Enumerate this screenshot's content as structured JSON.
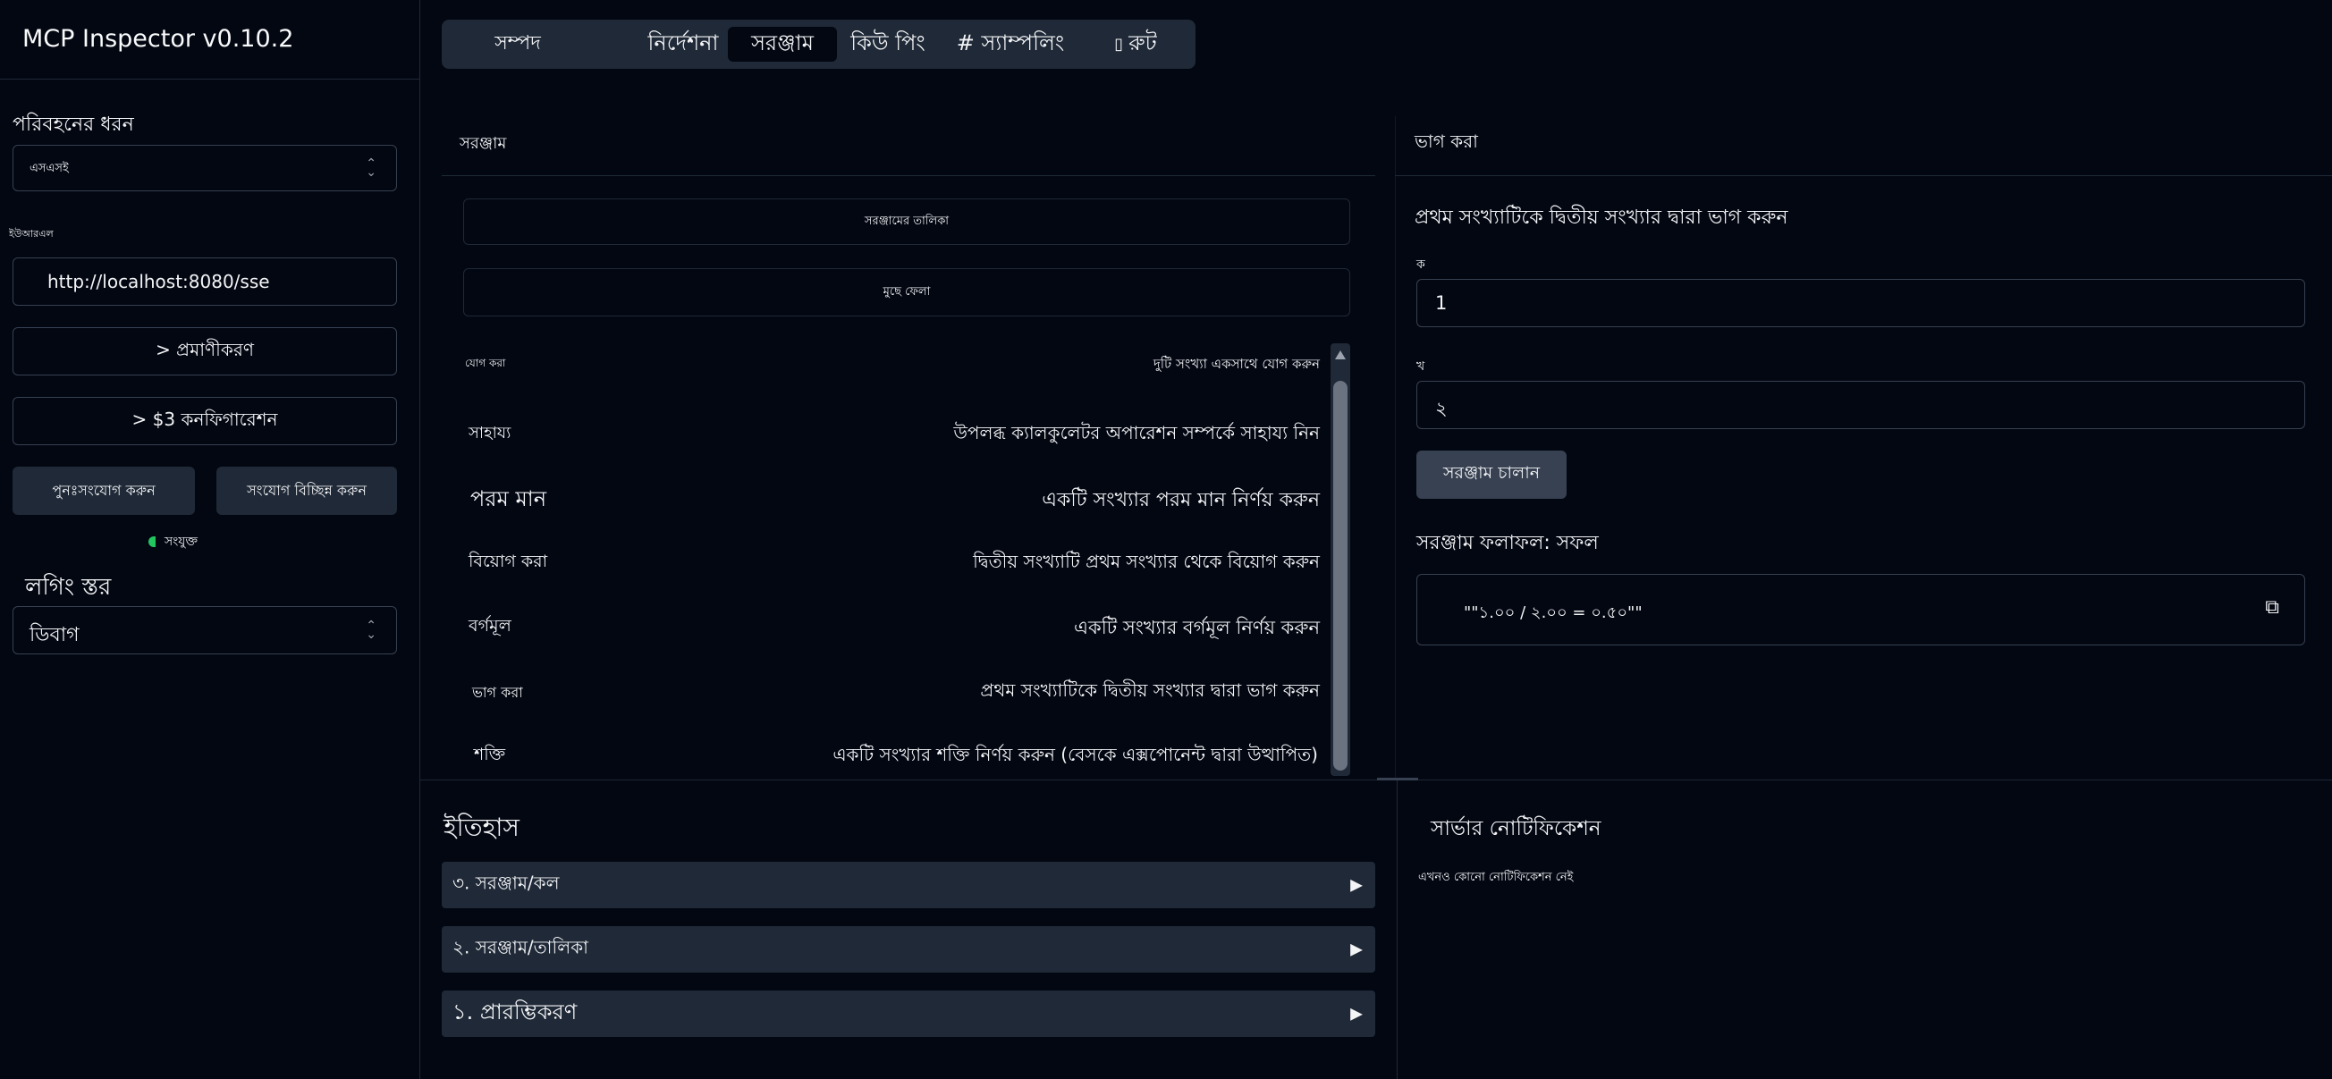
{
  "app": {
    "title": "MCP Inspector v0.10.2"
  },
  "sidebar": {
    "transport_label": "পরিবহনের ধরন",
    "transport_value": "এসএসই",
    "url_label": "ইউআরএল",
    "url_value": "http://localhost:8080/sse",
    "auth_label": "> প্রমাণীকরণ",
    "config_label": "> $3 কনফিগারেশন",
    "reconnect_label": "পুনঃসংযোগ করুন",
    "disconnect_label": "সংযোগ বিচ্ছিন্ন করুন",
    "status_text": "সংযুক্ত",
    "status_color": "#22c55e",
    "log_label": "লগিং স্তর",
    "log_value": "ডিবাগ"
  },
  "tabs": [
    {
      "label": "সম্পদ"
    },
    {
      "label": "নির্দেশনা"
    },
    {
      "label": "সরঞ্জাম"
    },
    {
      "label": "কিউ পিং"
    },
    {
      "label": "# স্যাম্পলিং"
    },
    {
      "label": "রুট"
    }
  ],
  "tools_panel": {
    "heading": "সরঞ্জাম",
    "list_button": "সরঞ্জামের তালিকা",
    "clear_button": "মুছে ফেলা",
    "items": [
      {
        "name": "যোগ করা",
        "desc": "দুটি সংখ্যা একসাথে যোগ করুন"
      },
      {
        "name": "সাহায্য",
        "desc": "উপলব্ধ ক্যালকুলেটর অপারেশন সম্পর্কে সাহায্য নিন"
      },
      {
        "name": "পরম মান",
        "desc": "একটি সংখ্যার পরম মান নির্ণয় করুন"
      },
      {
        "name": "বিয়োগ করা",
        "desc": "দ্বিতীয় সংখ্যাটি প্রথম সংখ্যার থেকে বিয়োগ করুন"
      },
      {
        "name": "বর্গমূল",
        "desc": "একটি সংখ্যার বর্গমূল নির্ণয় করুন"
      },
      {
        "name": "ভাগ করা",
        "desc": "প্রথম সংখ্যাটিকে দ্বিতীয় সংখ্যার দ্বারা ভাগ করুন"
      },
      {
        "name": "শক্তি",
        "desc": "একটি সংখ্যার শক্তি নির্ণয় করুন (বেসকে এক্সপোনেন্ট দ্বারা উত্থাপিত)"
      }
    ]
  },
  "detail_panel": {
    "heading": "ভাগ করা",
    "description": "প্রথম সংখ্যাটিকে দ্বিতীয় সংখ্যার দ্বারা ভাগ করুন",
    "field_a_label": "ক",
    "field_a_value": "1",
    "field_b_label": "খ",
    "field_b_value": "২",
    "run_button": "সরঞ্জাম চালান",
    "result_label": "সরঞ্জাম ফলাফল: সফল",
    "result_value": "\"\"১.০০ / ২.০০ = ০.৫০\"\""
  },
  "history": {
    "heading": "ইতিহাস",
    "items": [
      {
        "label": "৩. সরঞ্জাম/কল"
      },
      {
        "label": "২. সরঞ্জাম/তালিকা"
      },
      {
        "label": "১. প্রারম্ভিকরণ"
      }
    ]
  },
  "notifications": {
    "heading": "সার্ভার নোটিফিকেশন",
    "empty_text": "এখনও কোনো নোটিফিকেশন নেই"
  }
}
